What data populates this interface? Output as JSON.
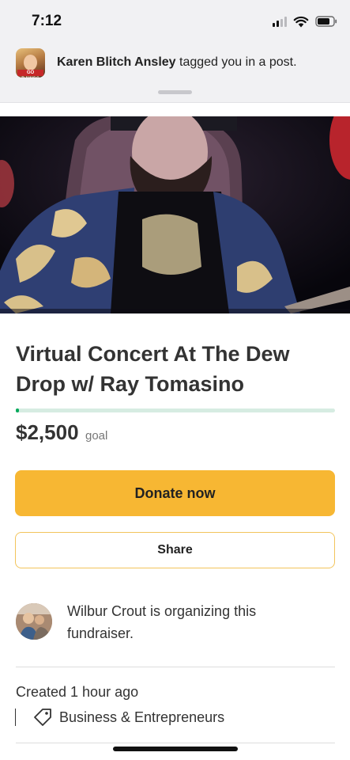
{
  "status_bar": {
    "time": "7:12",
    "icons": [
      "cellular-signal-icon",
      "wifi-icon",
      "battery-icon"
    ]
  },
  "notification": {
    "sender_name": "Karen Blitch Ansley",
    "message": "tagged you in a post.",
    "avatar_badge": "GO DAWGS"
  },
  "campaign": {
    "title": "Virtual Concert At The Dew Drop w/ Ray Tomasino",
    "amount": "$2,500",
    "amount_label": "goal",
    "progress_fraction": 0.01,
    "donate_label": "Donate now",
    "share_label": "Share",
    "organizer_text": "Wilbur Crout is organizing this fundraiser.",
    "created": "Created 1 hour ago",
    "category": "Business & Entrepreneurs",
    "category_icon": "tag-icon"
  },
  "colors": {
    "accent_yellow": "#f7b733",
    "progress_green": "#02a95c",
    "progress_track": "#d6ece2",
    "text_dark": "#333333"
  }
}
